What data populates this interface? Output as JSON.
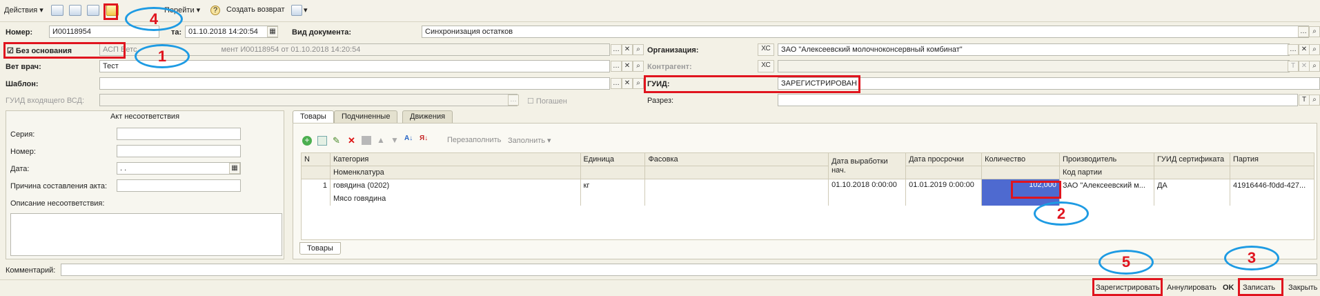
{
  "toolbar": {
    "actions": "Действия ▾",
    "goto": "Перейти ▾",
    "help": "?",
    "create_return": "Создать возврат",
    "print": "▾"
  },
  "header": {
    "number_label": "Номер:",
    "number_value": "И00118954",
    "date_label": "та:",
    "date_value": "01.10.2018 14:20:54",
    "doc_type_label": "Вид документа:",
    "doc_type_value": "Синхронизация остатков",
    "no_basis_label": "Без основания",
    "basis_value": "АСП Ветс",
    "basis_value_tail": "мент И00118954 от 01.10.2018 14:20:54",
    "vet_label": "Вет врач:",
    "vet_value": "Тест",
    "template_label": "Шаблон:",
    "template_value": "",
    "guid_in_label": "ГУИД входящего ВСД:",
    "repaid_label": "Погашен",
    "org_label": "Организация:",
    "org_code": "ХС",
    "org_value": "ЗАО \"Алексеевский молочноконсервный комбинат\"",
    "contractor_label": "Контрагент:",
    "contractor_code": "ХС",
    "guid_label": "ГУИД:",
    "guid_value": "ЗАРЕГИСТРИРОВАН",
    "section_label": "Разрез:"
  },
  "nonconformity": {
    "title": "Акт несоответствия",
    "series_label": "Серия:",
    "number_label": "Номер:",
    "date_label": "Дата:",
    "date_value": " .  .",
    "reason_label": "Причина составления акта:",
    "desc_label": "Описание несоответствия:"
  },
  "tabs": [
    "Товары",
    "Подчиненные",
    "Движения"
  ],
  "goods_toolbar": {
    "refill": "Перезаполнить",
    "fill": "Заполнить ▾"
  },
  "table": {
    "headers": [
      "N",
      "Категория",
      "Единица",
      "Фасовка",
      "Дата выработки нач.",
      "Дата просрочки",
      "Количество",
      "Производитель",
      "ГУИД сертификата",
      "Партия"
    ],
    "subheaders": {
      "category": "Номенклатура",
      "producer": "Код партии"
    },
    "row": {
      "n": "1",
      "category": "говядина (0202)",
      "nomenclature": "Мясо говядина",
      "unit": "кг",
      "pack": "",
      "prod_date": "01.10.2018 0:00:00",
      "expiry": "01.01.2019 0:00:00",
      "qty": "102,000",
      "producer": "ЗАО \"Алексеевский м...",
      "guid_cert": "ДА",
      "batch": "41916446-f0dd-427..."
    }
  },
  "bottom_tab": "Товары",
  "comment_label": "Комментарий:",
  "footer": {
    "register": "Зарегистрировать",
    "annul": "Аннулировать",
    "ok": "OK",
    "save": "Записать",
    "close": "Закрыть"
  },
  "callouts": [
    "1",
    "2",
    "3",
    "4",
    "5"
  ]
}
